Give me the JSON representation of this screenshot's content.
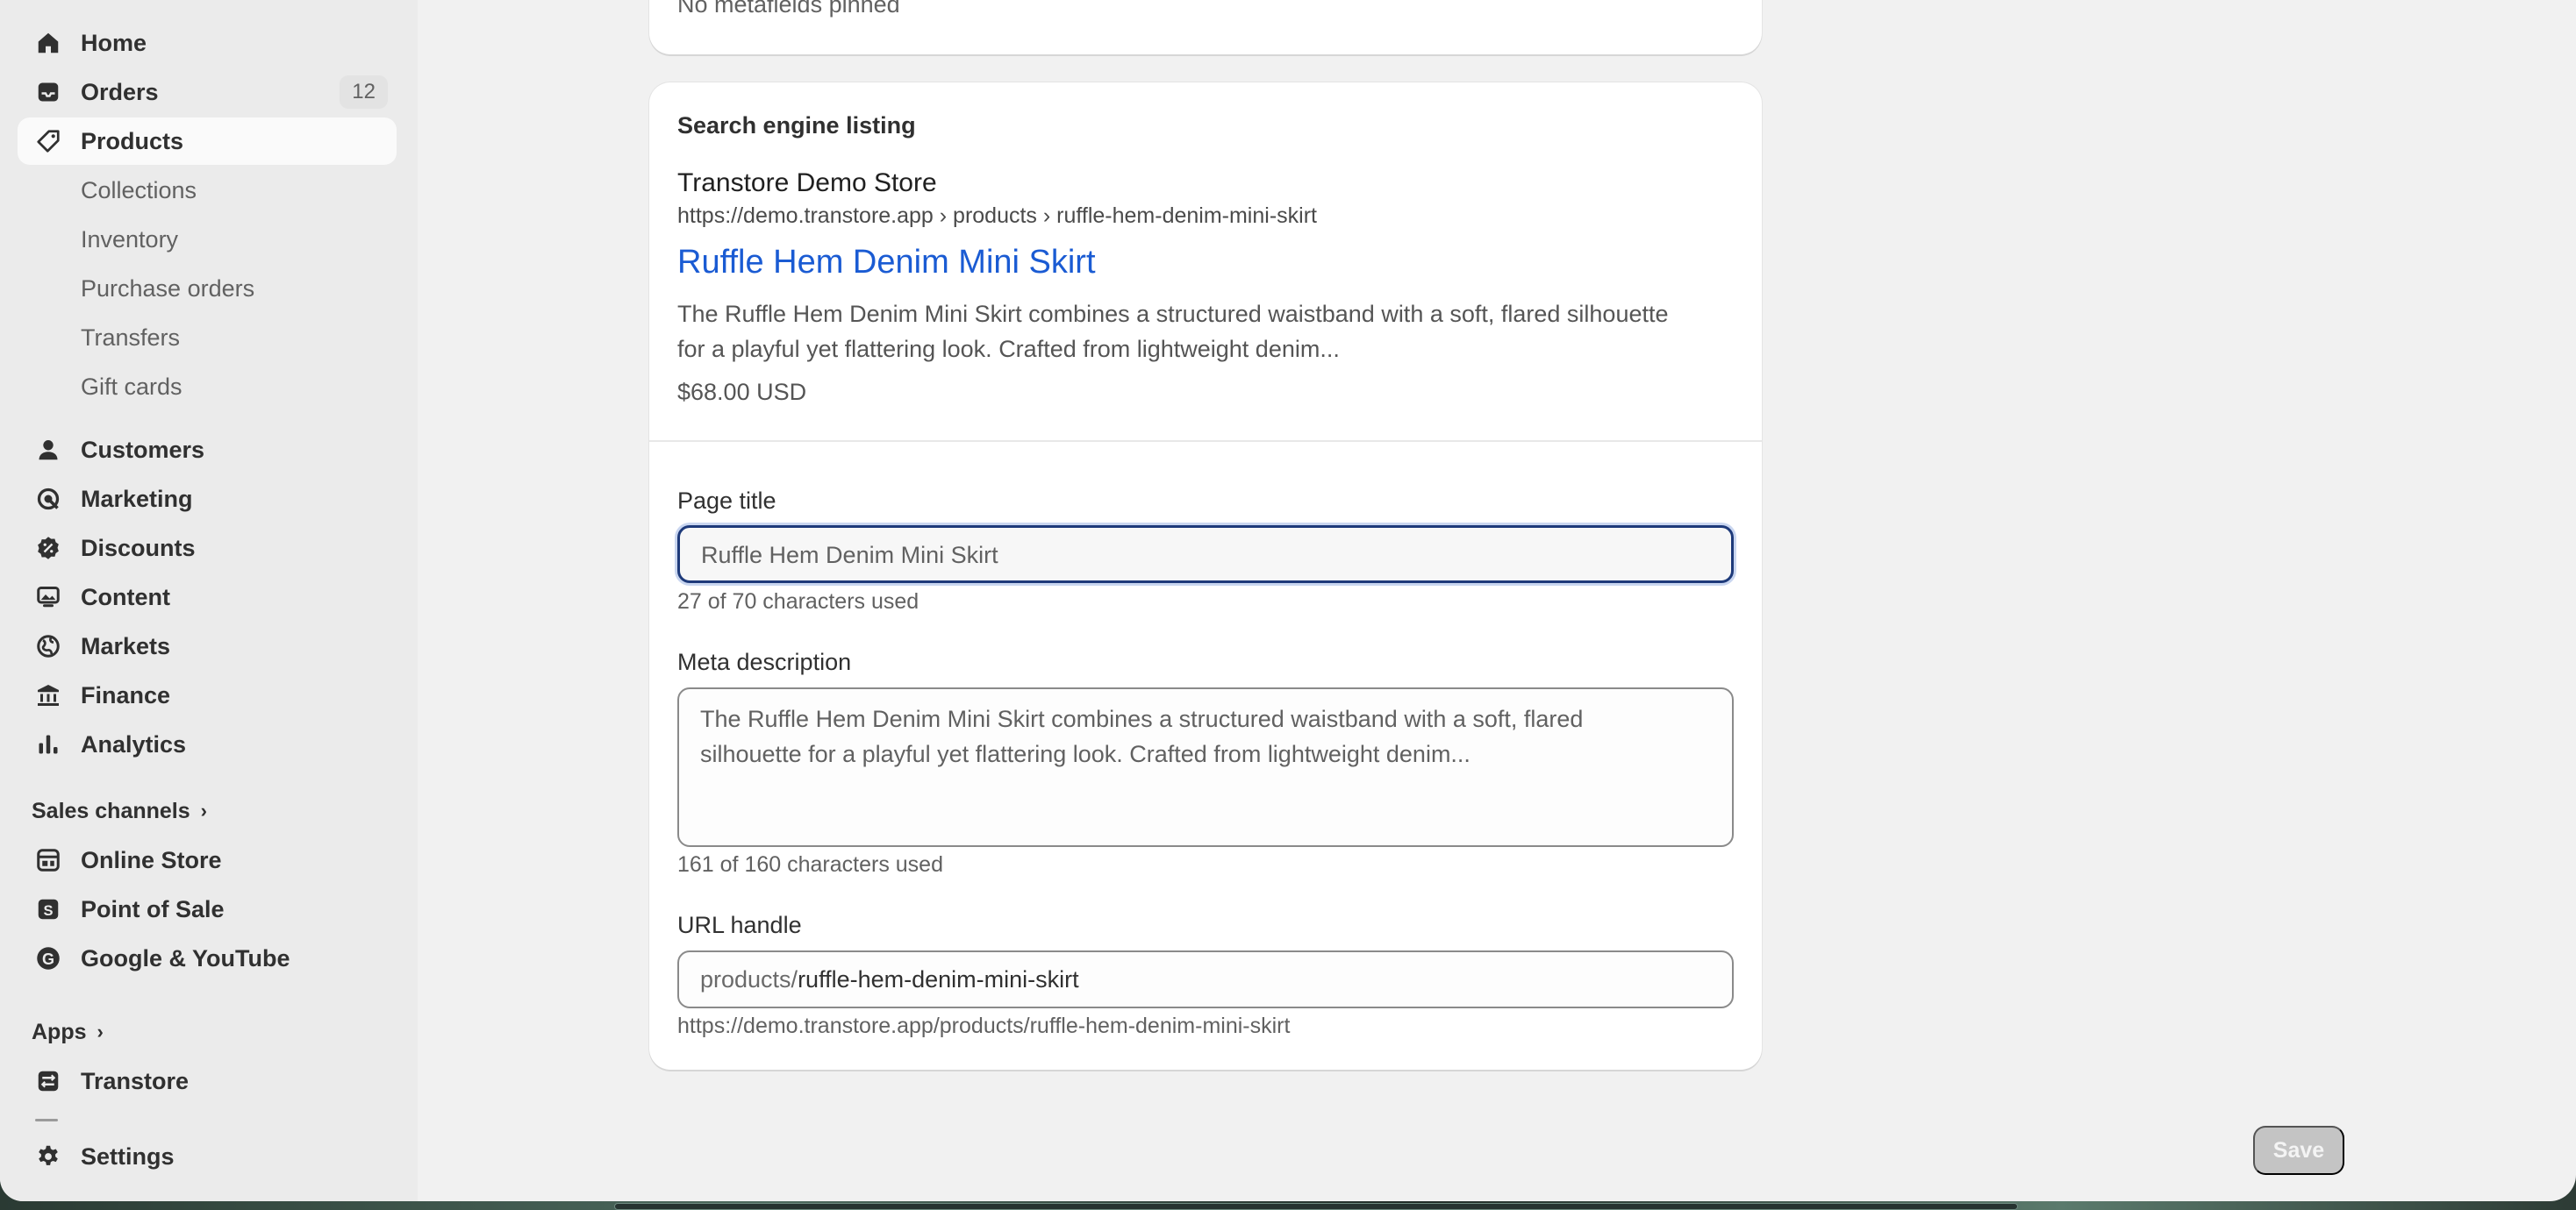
{
  "sidebar": {
    "home": "Home",
    "orders": "Orders",
    "orders_badge": "12",
    "products": "Products",
    "sub": {
      "collections": "Collections",
      "inventory": "Inventory",
      "purchase_orders": "Purchase orders",
      "transfers": "Transfers",
      "gift_cards": "Gift cards"
    },
    "customers": "Customers",
    "marketing": "Marketing",
    "discounts": "Discounts",
    "content": "Content",
    "markets": "Markets",
    "finance": "Finance",
    "analytics": "Analytics",
    "sales_channels_heading": "Sales channels",
    "online_store": "Online Store",
    "point_of_sale": "Point of Sale",
    "google_youtube": "Google & YouTube",
    "apps_heading": "Apps",
    "transtore": "Transtore",
    "settings": "Settings"
  },
  "metafields_card": {
    "text": "No metafields pinned"
  },
  "seo": {
    "heading": "Search engine listing",
    "preview": {
      "store_name": "Transtore Demo Store",
      "breadcrumb_url": "https://demo.transtore.app › products › ruffle-hem-denim-mini-skirt",
      "title": "Ruffle Hem Denim Mini Skirt",
      "description_line1": "The Ruffle Hem Denim Mini Skirt combines a structured waistband with a soft, flared silhouette",
      "description_line2": "for a playful yet flattering look. Crafted from lightweight denim...",
      "price": "$68.00 USD"
    },
    "page_title": {
      "label": "Page title",
      "value": "Ruffle Hem Denim Mini Skirt",
      "helper": "27 of 70 characters used"
    },
    "meta_description": {
      "label": "Meta description",
      "value_line1": "The Ruffle Hem Denim Mini Skirt combines a structured waistband with a soft, flared",
      "value_line2": "silhouette for a playful yet flattering look. Crafted from lightweight denim...",
      "helper": "161 of 160 characters used"
    },
    "url_handle": {
      "label": "URL handle",
      "prefix": "products/",
      "value": "ruffle-hem-denim-mini-skirt",
      "helper": "https://demo.transtore.app/products/ruffle-hem-denim-mini-skirt"
    }
  },
  "actions": {
    "save": "Save"
  },
  "colors": {
    "accent_link": "#1a5bd3",
    "focus_border": "#1e3a7a",
    "sidebar_bg": "#ebebeb",
    "page_bg": "#f1f1f1"
  }
}
